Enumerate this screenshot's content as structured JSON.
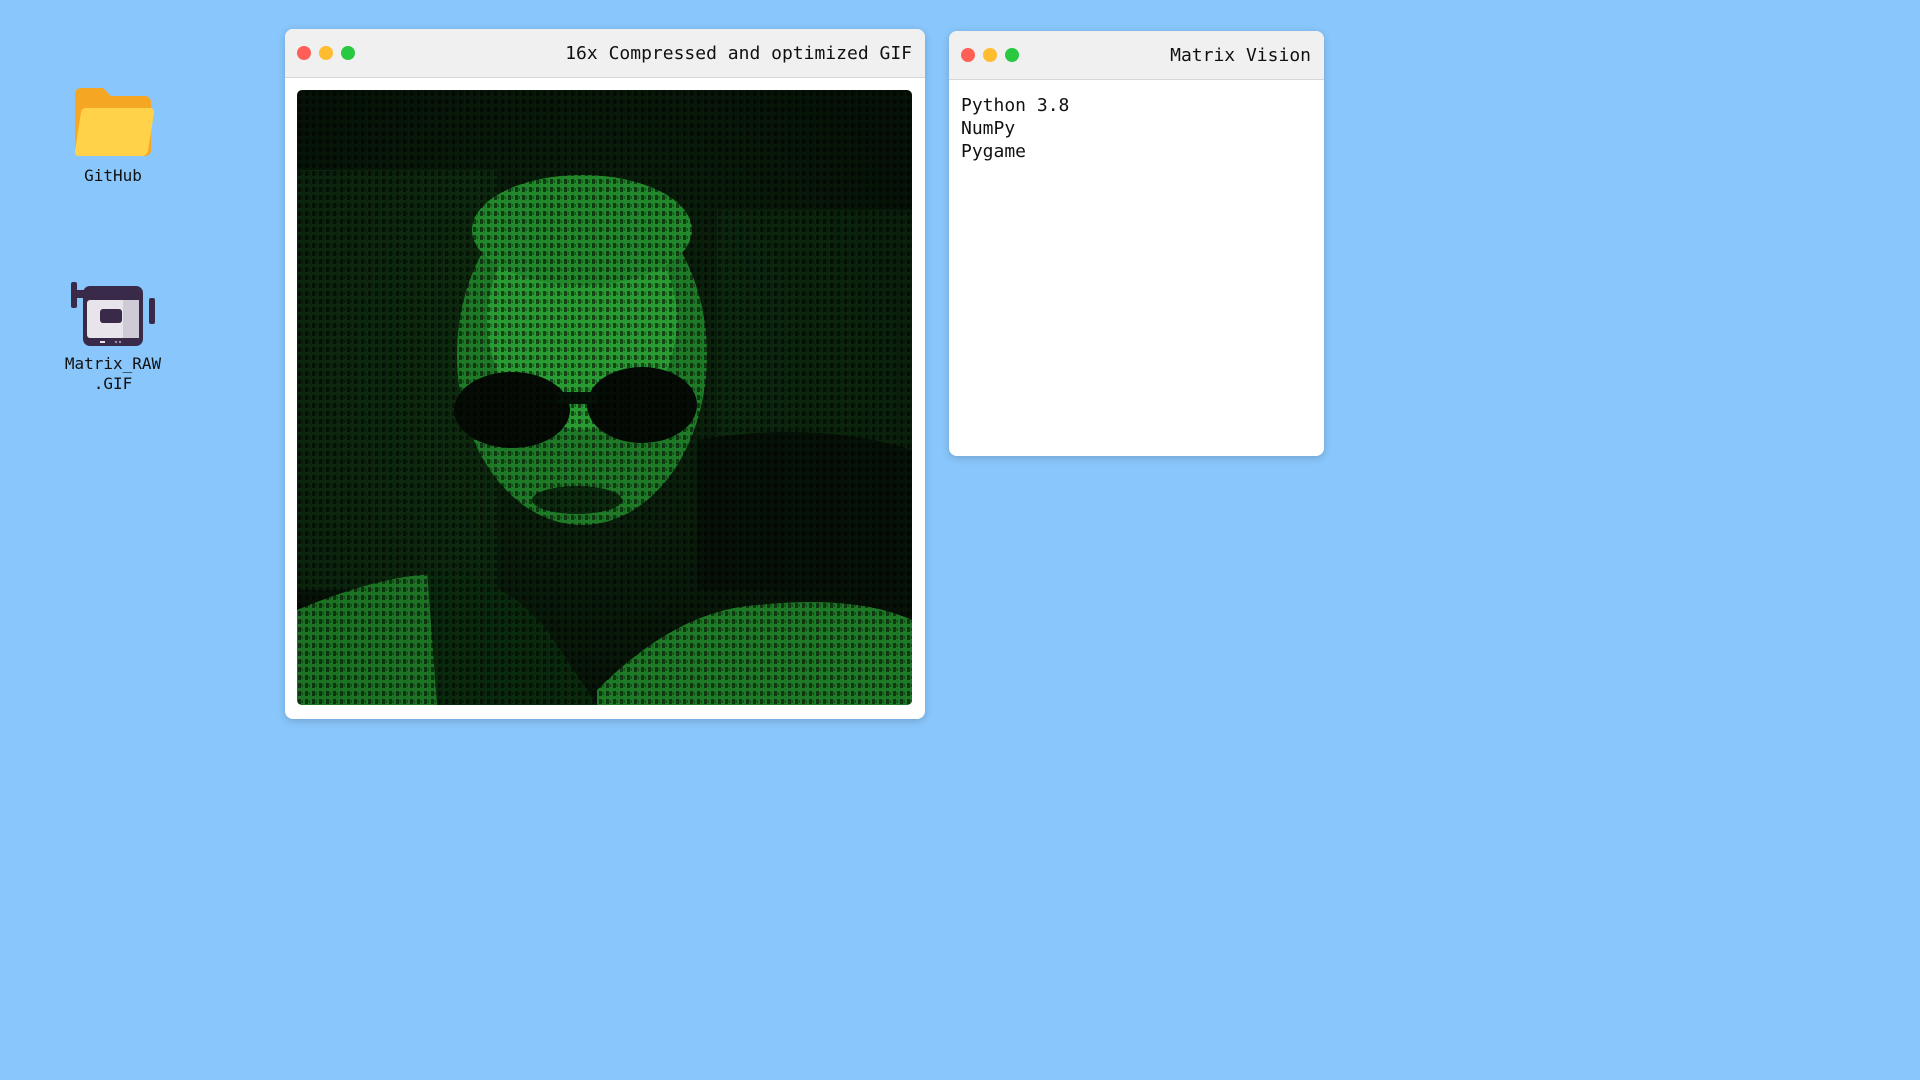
{
  "desktop": {
    "background": "#89c6fb",
    "icons": [
      {
        "label": "GitHub",
        "icon": "folder-icon"
      },
      {
        "label": "Matrix_RAW\n.GIF",
        "icon": "video-camera-icon"
      }
    ]
  },
  "windows": {
    "gif": {
      "title": "16x Compressed and optimized GIF",
      "image": "matrix-style green code portrait of a man wearing sunglasses"
    },
    "matrix": {
      "title": "Matrix Vision",
      "lines": [
        "Python 3.8",
        "NumPy",
        "Pygame"
      ]
    }
  },
  "colors": {
    "close": "#ff5f57",
    "minimize": "#febc2e",
    "maximize": "#28c840",
    "matrix_green": "#2fbf3a"
  }
}
